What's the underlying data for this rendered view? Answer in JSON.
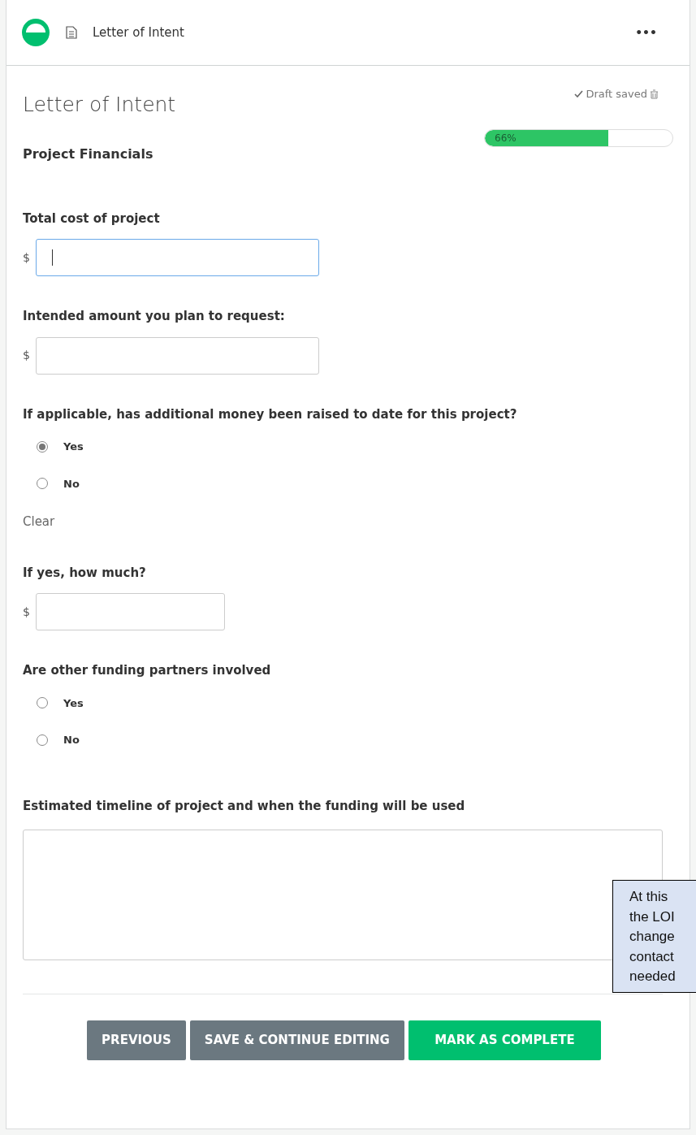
{
  "header": {
    "title": "Letter of Intent",
    "menu": "•••"
  },
  "form": {
    "title": "Letter of Intent",
    "draft_status": "Draft saved",
    "progress": {
      "level": 0.66,
      "label": "66%"
    },
    "section": "Project Financials"
  },
  "fields": [
    {
      "kind": "money",
      "label": "Total cost of project",
      "prefix": "$",
      "focused": true
    },
    {
      "kind": "money",
      "label": "Intended amount you plan to request:",
      "prefix": "$",
      "focused": false
    },
    {
      "kind": "radio",
      "label": "If applicable, has additional money been raised to date for this project?",
      "options": [
        {
          "label": "Yes",
          "selected": true
        },
        {
          "label": "No",
          "selected": false
        }
      ],
      "clear": "Clear"
    },
    {
      "kind": "short-money",
      "label": "If yes, how much?",
      "prefix": "$",
      "focused": false
    },
    {
      "kind": "radio",
      "label": "Are other funding partners involved",
      "options": [
        {
          "label": "Yes",
          "selected": false
        },
        {
          "label": "No",
          "selected": false
        }
      ]
    },
    {
      "kind": "textarea",
      "label": "Estimated timeline of project and when the funding will be used"
    }
  ],
  "buttons": [
    {
      "label": "PREVIOUS",
      "kind": "secondary"
    },
    {
      "label": "SAVE & CONTINUE EDITING",
      "kind": "secondary"
    },
    {
      "label": "MARK AS COMPLETE",
      "kind": "primary"
    }
  ],
  "callout": {
    "lines": [
      "At this",
      "the LOI",
      "change",
      "contact",
      "needed"
    ]
  }
}
